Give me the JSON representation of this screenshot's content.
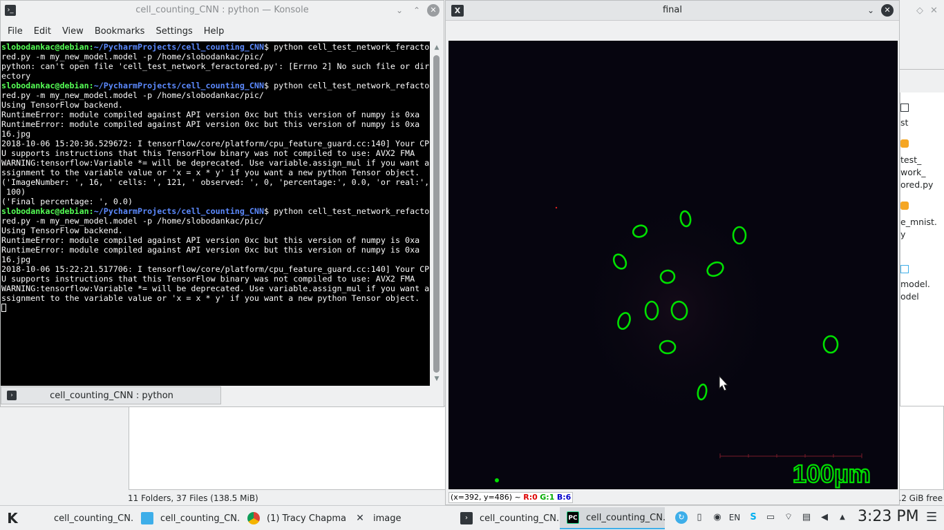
{
  "file_manager": {
    "status": "11 Folders, 37 Files (138.5 MiB)",
    "free_space": ".2 GiB free",
    "right_items": [
      "st",
      "test_",
      "work_",
      "ored.py",
      "e_mnist.",
      "y",
      "model.",
      "odel"
    ]
  },
  "konsole": {
    "title": "cell_counting_CNN : python — Konsole",
    "menu": [
      "File",
      "Edit",
      "View",
      "Bookmarks",
      "Settings",
      "Help"
    ],
    "tab_label": "cell_counting_CNN : python",
    "prompt_user": "slobodankac@debian",
    "prompt_path": "~/PycharmProjects/cell_counting_CNN",
    "lines": [
      {
        "type": "prompt",
        "cmd": "python cell_test_network_feracto"
      },
      {
        "type": "out",
        "text": "red.py -m my_new_model.model -p /home/slobodankac/pic/"
      },
      {
        "type": "out",
        "text": "python: can't open file 'cell_test_network_feractored.py': [Errno 2] No such file or dir"
      },
      {
        "type": "out",
        "text": "ectory"
      },
      {
        "type": "prompt",
        "cmd": "python cell_test_network_refacto"
      },
      {
        "type": "out",
        "text": "red.py -m my_new_model.model -p /home/slobodankac/pic/"
      },
      {
        "type": "out",
        "text": "Using TensorFlow backend."
      },
      {
        "type": "out",
        "text": "RuntimeError: module compiled against API version 0xc but this version of numpy is 0xa"
      },
      {
        "type": "out",
        "text": "RuntimeError: module compiled against API version 0xc but this version of numpy is 0xa"
      },
      {
        "type": "out",
        "text": "16.jpg"
      },
      {
        "type": "out",
        "text": "2018-10-06 15:20:36.529672: I tensorflow/core/platform/cpu_feature_guard.cc:140] Your CP"
      },
      {
        "type": "out",
        "text": "U supports instructions that this TensorFlow binary was not compiled to use: AVX2 FMA"
      },
      {
        "type": "out",
        "text": "WARNING:tensorflow:Variable *= will be deprecated. Use variable.assign_mul if you want a"
      },
      {
        "type": "out",
        "text": "ssignment to the variable value or 'x = x * y' if you want a new python Tensor object."
      },
      {
        "type": "out",
        "text": "('ImageNumber: ', 16, ' cells: ', 121, ' observed: ', 0, 'percentage:', 0.0, 'or real:',"
      },
      {
        "type": "out",
        "text": " 100)"
      },
      {
        "type": "out",
        "text": "('Final percentage: ', 0.0)"
      },
      {
        "type": "prompt",
        "cmd": "python cell_test_network_refacto"
      },
      {
        "type": "out",
        "text": "red.py -m my_new_model.model -p /home/slobodankac/pic/"
      },
      {
        "type": "out",
        "text": "Using TensorFlow backend."
      },
      {
        "type": "out",
        "text": "RuntimeError: module compiled against API version 0xc but this version of numpy is 0xa"
      },
      {
        "type": "out",
        "text": "RuntimeError: module compiled against API version 0xc but this version of numpy is 0xa"
      },
      {
        "type": "out",
        "text": "16.jpg"
      },
      {
        "type": "out",
        "text": "2018-10-06 15:22:21.517706: I tensorflow/core/platform/cpu_feature_guard.cc:140] Your CP"
      },
      {
        "type": "out",
        "text": "U supports instructions that this TensorFlow binary was not compiled to use: AVX2 FMA"
      },
      {
        "type": "out",
        "text": "WARNING:tensorflow:Variable *= will be deprecated. Use variable.assign_mul if you want a"
      },
      {
        "type": "out",
        "text": "ssignment to the variable value or 'x = x * y' if you want a new python Tensor object."
      },
      {
        "type": "cursor"
      }
    ]
  },
  "final_window": {
    "title": "final",
    "scale_label": "100µm",
    "status_coords": "(x=392, y=486) ~",
    "status_r": "R:0",
    "status_g": "G:1",
    "status_b": "B:6",
    "cell_outline_color": "#00e000"
  },
  "taskbar": {
    "tasks": [
      {
        "label": "cell_counting_CN...",
        "icon": "terminal-icon",
        "active": false
      },
      {
        "label": "cell_counting_CN...",
        "icon": "folder-icon",
        "active": false
      },
      {
        "label": "(1) Tracy Chapma...",
        "icon": "chrome-icon",
        "active": false
      },
      {
        "label": "image",
        "icon": "x-window-icon",
        "active": false
      },
      {
        "label": "cell_counting_CN...",
        "icon": "terminal-icon",
        "active": false
      },
      {
        "label": "cell_counting_CN...",
        "icon": "pycharm-icon",
        "active": true
      }
    ],
    "lang": "EN",
    "clock": "3:23 PM"
  }
}
